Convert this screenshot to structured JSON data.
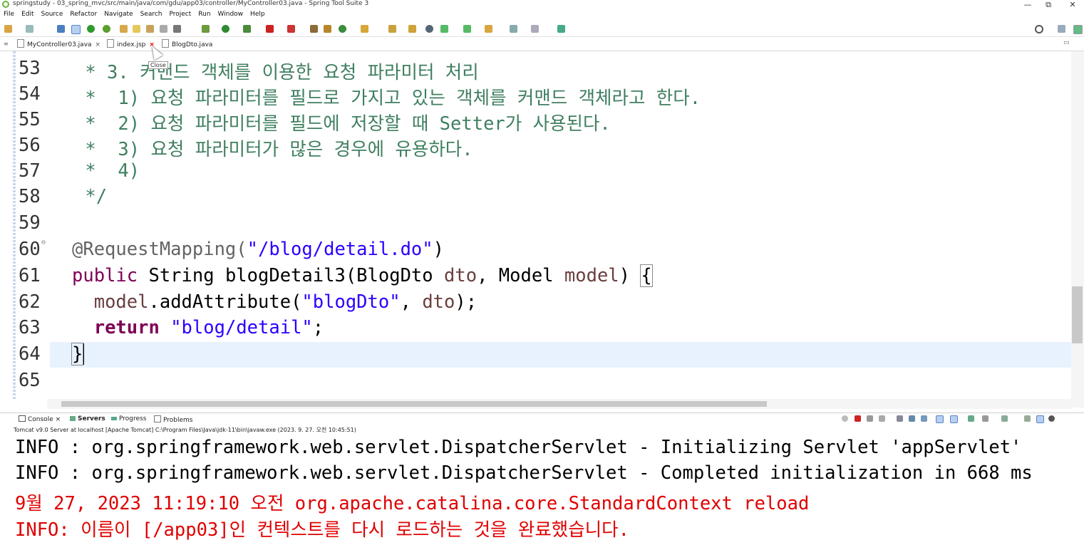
{
  "window": {
    "title": "springstudy - 03_spring_mvc/src/main/java/com/gdu/app03/controller/MyController03.java - Spring Tool Suite 3",
    "controls": [
      "—",
      "⧉",
      "✕"
    ]
  },
  "menu": [
    "File",
    "Edit",
    "Source",
    "Refactor",
    "Navigate",
    "Search",
    "Project",
    "Run",
    "Window",
    "Help"
  ],
  "editor_tabs": [
    {
      "label": "MyController03.java",
      "close": "×"
    },
    {
      "label": "index.jsp",
      "close": "×"
    },
    {
      "label": "BlogDto.java",
      "close": ""
    }
  ],
  "tooltip": "Close",
  "code_lines": [
    {
      "num": "53",
      "text": " * 3. 커맨드 객체를 이용한 요청 파라미터 처리"
    },
    {
      "num": "54",
      "text": " *  1) 요청 파라미터를 필드로 가지고 있는 객체를 커맨드 객체라고 한다."
    },
    {
      "num": "55",
      "text": " *  2) 요청 파라미터를 필드에 저장할 때 Setter가 사용된다."
    },
    {
      "num": "56",
      "text": " *  3) 요청 파라미터가 많은 경우에 유용하다."
    },
    {
      "num": "57",
      "text": " *  4)"
    },
    {
      "num": "58",
      "text": " */"
    },
    {
      "num": "59",
      "text": ""
    },
    {
      "num": "60",
      "annotation": "@RequestMapping(",
      "string": "\"/blog/detail.do\"",
      "close": ")"
    },
    {
      "num": "61",
      "kw": "public",
      "rest": " String blogDetail3(BlogDto ",
      "var1": "dto",
      "mid": ", Model ",
      "var2": "model",
      "end": ") ",
      "brace": "{"
    },
    {
      "num": "62",
      "pre": "  ",
      "field": "model",
      "call": ".addAttribute(",
      "string": "\"blogDto\"",
      "sep": ", ",
      "var": "dto",
      "end": ");"
    },
    {
      "num": "63",
      "pre": "  ",
      "kw": "return",
      "sp": " ",
      "string": "\"blog/detail\"",
      "end": ";"
    },
    {
      "num": "64",
      "text": "}"
    },
    {
      "num": "65",
      "text": ""
    }
  ],
  "console_tabs": [
    {
      "label": "Console",
      "close": "×"
    },
    {
      "label": "Servers",
      "close": ""
    },
    {
      "label": "Progress",
      "close": ""
    },
    {
      "label": "Problems",
      "close": ""
    }
  ],
  "console_description": "Tomcat v9.0 Server at localhost [Apache Tomcat] C:\\Program Files\\Java\\jdk-11\\bin\\javaw.exe  (2023. 9. 27. 오전 10:45:51)",
  "console_lines": [
    {
      "text": "INFO : org.springframework.web.servlet.DispatcherServlet - Initializing Servlet 'appServlet'",
      "color": "black"
    },
    {
      "text": "INFO : org.springframework.web.servlet.DispatcherServlet - Completed initialization in 668 ms",
      "color": "black"
    },
    {
      "text": "9월 27, 2023 11:19:10 오전 org.apache.catalina.core.StandardContext reload",
      "color": "red"
    },
    {
      "text": "INFO: 이름이 [/app03]인 컨텍스트를 다시 로드하는 것을 완료했습니다.",
      "color": "red"
    }
  ]
}
